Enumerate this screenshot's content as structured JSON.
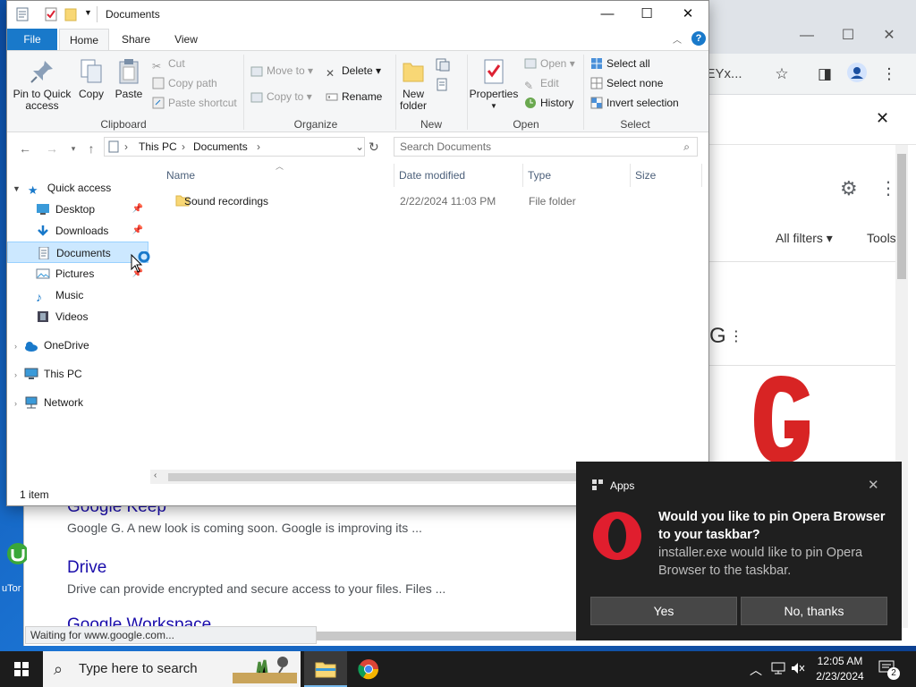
{
  "explorer": {
    "title": "Documents",
    "tabs": [
      "File",
      "Home",
      "Share",
      "View"
    ],
    "ribbon": {
      "clipboard": {
        "pin": "Pin to Quick access",
        "copy": "Copy",
        "paste": "Paste",
        "cut": "Cut",
        "copy_path": "Copy path",
        "paste_shortcut": "Paste shortcut",
        "label": "Clipboard"
      },
      "organize": {
        "move_to": "Move to",
        "copy_to": "Copy to",
        "delete": "Delete",
        "rename": "Rename",
        "label": "Organize"
      },
      "new": {
        "new_folder": "New folder",
        "label": "New"
      },
      "open": {
        "properties": "Properties",
        "open": "Open",
        "edit": "Edit",
        "history": "History",
        "label": "Open"
      },
      "select": {
        "select_all": "Select all",
        "select_none": "Select none",
        "invert": "Invert selection",
        "label": "Select"
      }
    },
    "breadcrumb": [
      "This PC",
      "Documents"
    ],
    "search_placeholder": "Search Documents",
    "nav": {
      "quick_access": "Quick access",
      "items": [
        "Desktop",
        "Downloads",
        "Documents",
        "Pictures",
        "Music",
        "Videos"
      ],
      "onedrive": "OneDrive",
      "this_pc": "This PC",
      "network": "Network"
    },
    "columns": {
      "name": "Name",
      "date": "Date modified",
      "type": "Type",
      "size": "Size"
    },
    "files": [
      {
        "name": "Sound recordings",
        "date": "2/22/2024 11:03 PM",
        "type": "File folder",
        "size": ""
      }
    ],
    "status": "1 item"
  },
  "chrome": {
    "url_fragment": "lYgwEYx...",
    "all_filters": "All filters",
    "tools": "Tools",
    "results": [
      {
        "title": "Google Keep",
        "snippet": "Google G. A new look is coming soon. Google is improving its ..."
      },
      {
        "title": "Drive",
        "snippet": "Drive can provide encrypted and secure access to your files. Files ..."
      },
      {
        "title": "Google Workspace",
        "snippet": ""
      }
    ],
    "status_text": "Waiting for www.google.com..."
  },
  "toast": {
    "app": "Apps",
    "title": "Would you like to pin Opera Browser to your taskbar?",
    "body": "installer.exe would like to pin Opera Browser to the taskbar.",
    "yes": "Yes",
    "no": "No, thanks"
  },
  "taskbar": {
    "search_placeholder": "Type here to search",
    "time": "12:05 AM",
    "date": "2/23/2024",
    "notifications": "2"
  },
  "desktop": {
    "icon_label": "uTor"
  }
}
